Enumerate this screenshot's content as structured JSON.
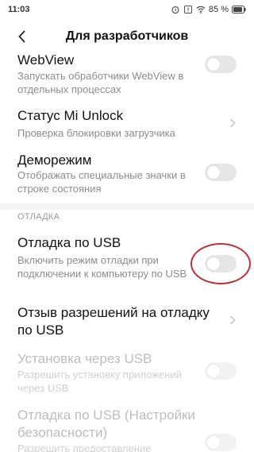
{
  "status_bar": {
    "time": "11:03",
    "battery": "85 %",
    "icons": [
      "alarm-icon",
      "warning-icon",
      "wifi-icon",
      "battery-icon"
    ]
  },
  "header": {
    "title": "Для разработчиков",
    "back_icon": "chevron-left-icon"
  },
  "items": [
    {
      "title": "WebView",
      "subtitle": "Запускать обработчики WebView в отдельных процессах",
      "control": "toggle",
      "checked": false,
      "enabled": true
    },
    {
      "title": "Статус Mi Unlock",
      "subtitle": "Проверка блокировки загрузчика",
      "control": "chevron",
      "enabled": true
    },
    {
      "title": "Деморежим",
      "subtitle": "Отображать специальные значки в строке состояния",
      "control": "toggle",
      "checked": false,
      "enabled": true
    }
  ],
  "section": {
    "label": "ОТЛАДКА",
    "items": [
      {
        "title": "Отладка по USB",
        "subtitle": "Включить режим отладки при подключении к компьютеру по USB",
        "control": "toggle",
        "checked": false,
        "enabled": true,
        "highlighted": true
      },
      {
        "title": "Отзыв разрешений на отладку по USB",
        "control": "chevron",
        "enabled": true
      },
      {
        "title": "Установка через USB",
        "subtitle": "Разрешить установку приложений через USB",
        "control": "toggle",
        "checked": false,
        "enabled": false
      },
      {
        "title": "Отладка по USB (Настройки безопасности)",
        "subtitle": "Разрешить предоставление",
        "control": "toggle",
        "checked": false,
        "enabled": false
      }
    ]
  },
  "colors": {
    "highlight_ring": "#b8333a",
    "toggle_off": "#e6e6e6",
    "secondary_text": "#8c8c8c"
  }
}
